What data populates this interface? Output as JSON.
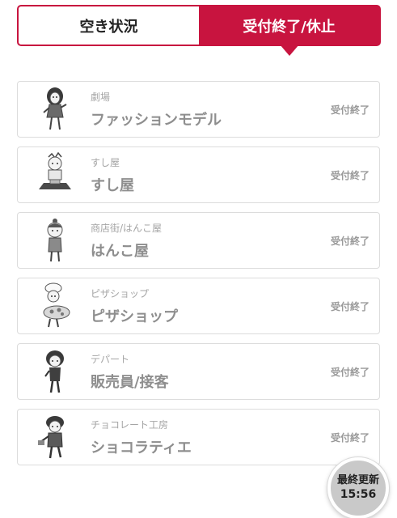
{
  "tabs": [
    {
      "label": "空き状況",
      "active": false
    },
    {
      "label": "受付終了/休止",
      "active": true
    }
  ],
  "stores": [
    {
      "category": "劇場",
      "name": "ファッションモデル",
      "status": "受付終了",
      "icon": "fashion-model-character-icon"
    },
    {
      "category": "すし屋",
      "name": "すし屋",
      "status": "受付終了",
      "icon": "sushi-chef-character-icon"
    },
    {
      "category": "商店街/はんこ屋",
      "name": "はんこ屋",
      "status": "受付終了",
      "icon": "stamp-shop-character-icon"
    },
    {
      "category": "ピザショップ",
      "name": "ピザショップ",
      "status": "受付終了",
      "icon": "pizza-chef-character-icon"
    },
    {
      "category": "デパート",
      "name": "販売員/接客",
      "status": "受付終了",
      "icon": "salesperson-character-icon"
    },
    {
      "category": "チョコレート工房",
      "name": "ショコラティエ",
      "status": "受付終了",
      "icon": "chocolatier-character-icon"
    }
  ],
  "update": {
    "label": "最終更新",
    "time": "15:56"
  },
  "colors": {
    "accent": "#c8143f",
    "muted_text": "#8e8e8e",
    "border": "#dcdcdc"
  }
}
